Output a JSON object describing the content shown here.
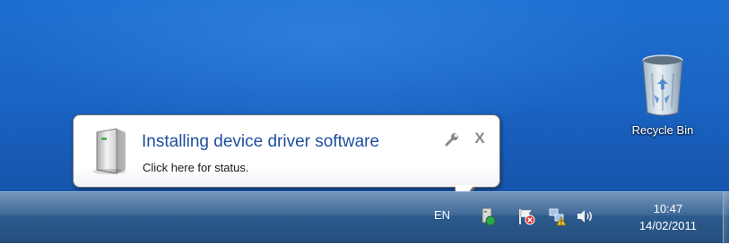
{
  "desktop": {
    "recycle_bin_label": "Recycle Bin"
  },
  "balloon": {
    "title": "Installing device driver software",
    "subtitle": "Click here for status.",
    "options_icon": "wrench-icon",
    "close_icon": "close-icon",
    "close_glyph": "X"
  },
  "taskbar": {
    "language": "EN",
    "tray_icons": [
      "device-install-icon",
      "action-center-flag-icon",
      "network-warning-icon",
      "volume-icon"
    ],
    "time": "10:47",
    "date": "14/02/2011"
  },
  "colors": {
    "balloon_title": "#1f4e9e",
    "taskbar": "#2c5a8c",
    "desktop": "#1a63c2"
  }
}
